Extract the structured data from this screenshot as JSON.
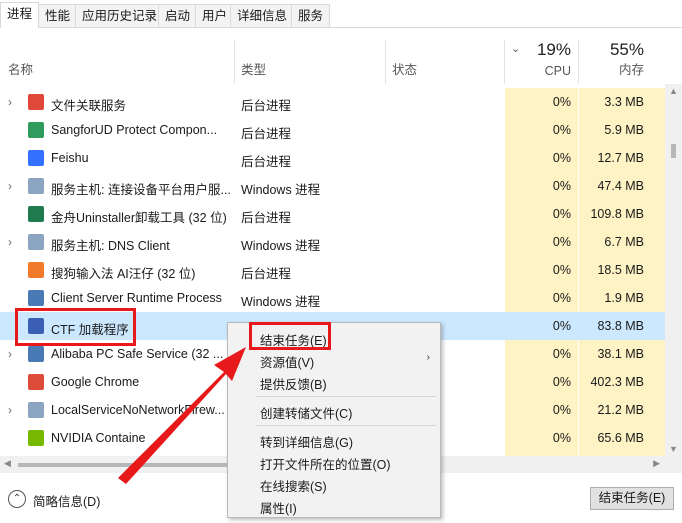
{
  "tabs": [
    "进程",
    "性能",
    "应用历史记录",
    "启动",
    "用户",
    "详细信息",
    "服务"
  ],
  "header": {
    "name": "名称",
    "type": "类型",
    "status": "状态",
    "cpu_pct": "19%",
    "cpu_label": "CPU",
    "mem_pct": "55%",
    "mem_label": "内存"
  },
  "rows": [
    {
      "name": "文件关联服务",
      "type": "后台进程",
      "cpu": "0%",
      "mem": "3.3 MB",
      "expand": "›",
      "icon_color": "#e0483a"
    },
    {
      "name": "SangforUD Protect Compon...",
      "type": "后台进程",
      "cpu": "0%",
      "mem": "5.9 MB",
      "expand": "",
      "icon_color": "#2f9b5c"
    },
    {
      "name": "Feishu",
      "type": "后台进程",
      "cpu": "0%",
      "mem": "12.7 MB",
      "expand": "",
      "icon_color": "#3370ff"
    },
    {
      "name": "服务主机: 连接设备平台用户服...",
      "type": "Windows 进程",
      "cpu": "0%",
      "mem": "47.4 MB",
      "expand": "›",
      "icon_color": "#8aa4c2"
    },
    {
      "name": "金舟Uninstaller卸载工具 (32 位)",
      "type": "后台进程",
      "cpu": "0%",
      "mem": "109.8 MB",
      "expand": "",
      "icon_color": "#1f7a4d"
    },
    {
      "name": "服务主机: DNS Client",
      "type": "Windows 进程",
      "cpu": "0%",
      "mem": "6.7 MB",
      "expand": "›",
      "icon_color": "#8aa4c2"
    },
    {
      "name": "搜狗输入法 AI汪仔 (32 位)",
      "type": "后台进程",
      "cpu": "0%",
      "mem": "18.5 MB",
      "expand": "",
      "icon_color": "#f07b2b"
    },
    {
      "name": "Client Server Runtime Process",
      "type": "Windows 进程",
      "cpu": "0%",
      "mem": "1.9 MB",
      "expand": "",
      "icon_color": "#4a7ab5"
    },
    {
      "name": "CTF 加载程序",
      "type": "",
      "cpu": "0%",
      "mem": "83.8 MB",
      "expand": "",
      "icon_color": "#3b5fb5"
    },
    {
      "name": "Alibaba PC Safe Service (32 ...",
      "type": "",
      "cpu": "0%",
      "mem": "38.1 MB",
      "expand": "›",
      "icon_color": "#4a7ab5"
    },
    {
      "name": "Google Chrome",
      "type": "",
      "cpu": "0%",
      "mem": "402.3 MB",
      "expand": "",
      "icon_color": "#dd4b39"
    },
    {
      "name": "LocalServiceNoNetworkFirew...",
      "type": "",
      "cpu": "0%",
      "mem": "21.2 MB",
      "expand": "›",
      "icon_color": "#8aa4c2"
    },
    {
      "name": "NVIDIA Containe",
      "type": "",
      "cpu": "0%",
      "mem": "65.6 MB",
      "expand": "",
      "icon_color": "#76b900"
    }
  ],
  "context_menu": {
    "items": [
      {
        "label": "结束任务(E)",
        "submenu": false
      },
      {
        "label": "资源值(V)",
        "submenu": true
      },
      {
        "label": "提供反馈(B)",
        "submenu": false
      },
      {
        "label": "创建转储文件(C)",
        "submenu": false
      },
      {
        "label": "转到详细信息(G)",
        "submenu": false
      },
      {
        "label": "打开文件所在的位置(O)",
        "submenu": false
      },
      {
        "label": "在线搜索(S)",
        "submenu": false
      },
      {
        "label": "属性(I)",
        "submenu": false
      }
    ],
    "submenu_arrow": "›"
  },
  "footer": {
    "fewer_details": "简略信息(D)",
    "end_task_button": "结束任务(E)",
    "fewer_icon": "⌃"
  },
  "colors": {
    "highlight_column": "#fdf3c4",
    "selected_row": "#cce8ff",
    "annotation_red": "#e8191a"
  }
}
